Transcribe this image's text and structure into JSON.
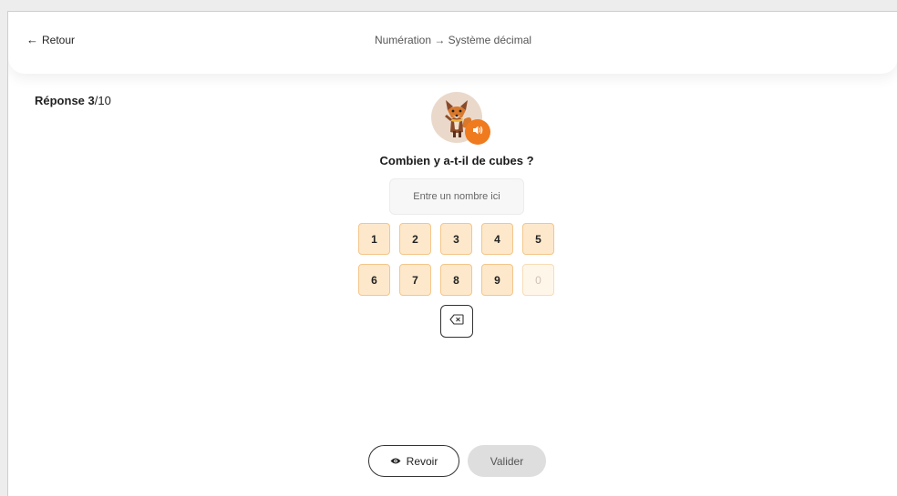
{
  "header": {
    "back_label": "Retour",
    "breadcrumb": "Numération → Système décimal"
  },
  "progress": {
    "label": "Réponse",
    "current": "3",
    "total": "/10"
  },
  "mascot": {
    "icon": "fox-mascot-icon",
    "audio_icon": "speaker-icon"
  },
  "question": "Combien y a-t-il de cubes ?",
  "answer": {
    "value": "",
    "placeholder": "Entre un nombre ici"
  },
  "keypad": {
    "row1": [
      "1",
      "2",
      "3",
      "4",
      "5"
    ],
    "row2": [
      "6",
      "7",
      "8",
      "9",
      "0"
    ],
    "disabled": [
      "0"
    ],
    "backspace_icon": "backspace-icon"
  },
  "actions": {
    "revoir_label": "Revoir",
    "revoir_icon": "eye-icon",
    "valider_label": "Valider"
  },
  "colors": {
    "accent": "#f07a1e",
    "key_bg": "#fde8cb",
    "key_border": "#f4c68a",
    "disabled_btn": "#dedede"
  }
}
